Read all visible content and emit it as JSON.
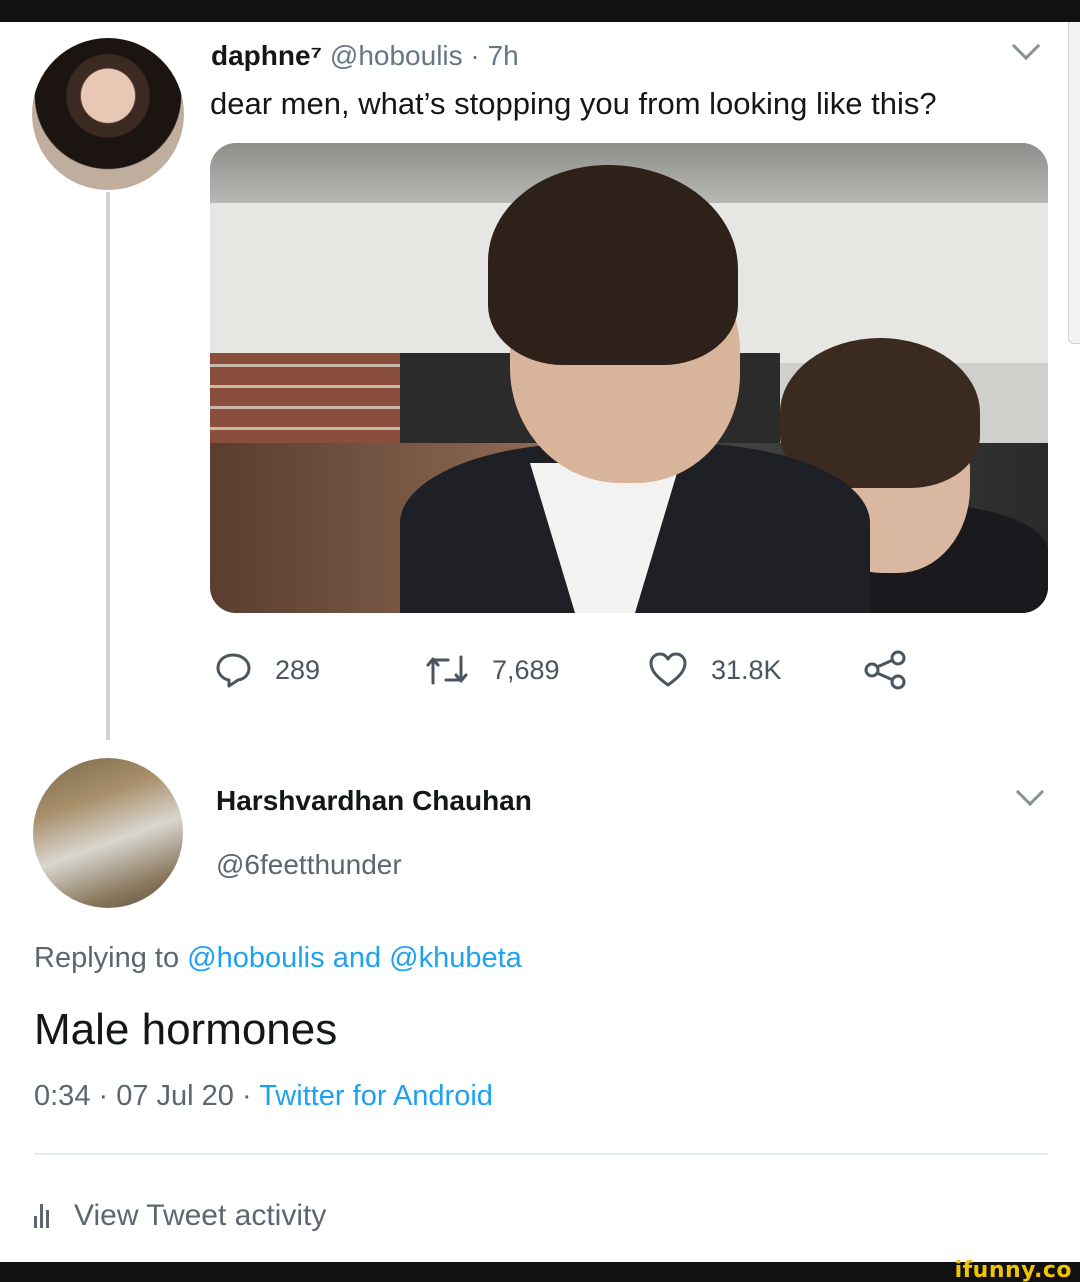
{
  "tweet": {
    "display_name": "daphne⁷",
    "handle": "@hoboulis",
    "time": "· 7h",
    "text": "dear men, what’s stopping you from looking like this?",
    "stats": {
      "replies": "289",
      "retweets": "7,689",
      "likes": "31.8K"
    },
    "icons": [
      "reply-icon",
      "retweet-icon",
      "like-icon",
      "share-icon",
      "chevron-down-icon"
    ]
  },
  "reply": {
    "display_name": "Harshvardhan Chauhan",
    "handle": "@6feetthunder",
    "replying_prefix": "Replying to",
    "replying_user1": "@hoboulis",
    "replying_and": "and",
    "replying_user2": "@khubeta",
    "text": "Male hormones",
    "timestamp": "0:34 · 07 Jul 20 ·",
    "source": "Twitter for Android"
  },
  "footer": {
    "view_activity": "View Tweet activity"
  },
  "watermark": "ifunny.co",
  "colors": {
    "link": "#1da1f2",
    "muted": "#5c6670",
    "text": "#14171a"
  }
}
